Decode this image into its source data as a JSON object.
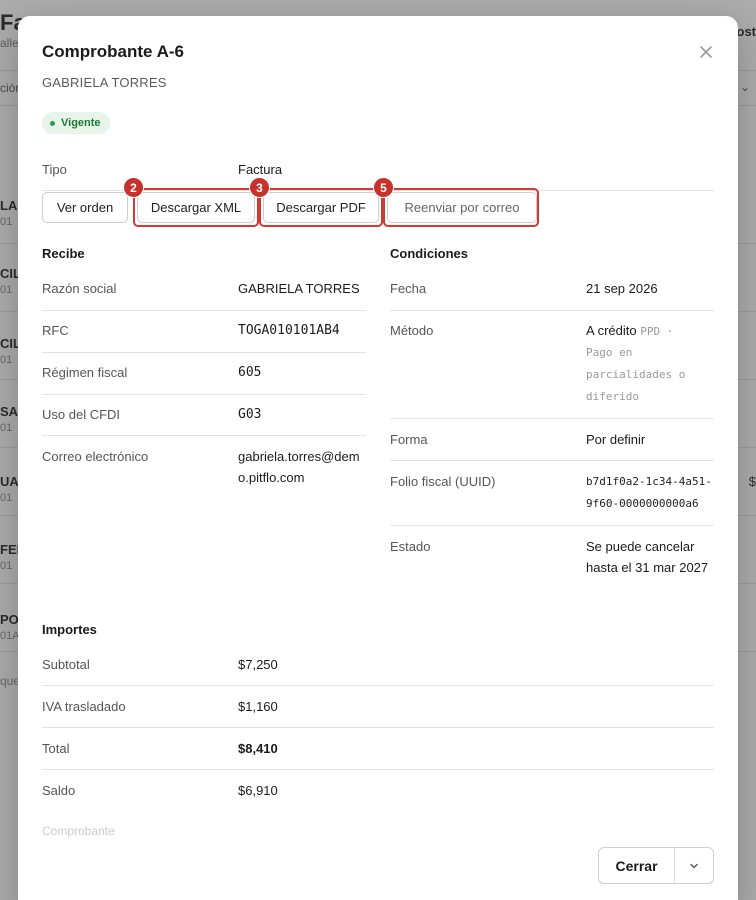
{
  "background": {
    "title": "Fac",
    "subtitle": "alle",
    "tab_text": "ción",
    "right_text": "ost",
    "rows": [
      {
        "name": "LA",
        "id": "01"
      },
      {
        "name": "CIL",
        "id": "01"
      },
      {
        "name": "CIL",
        "id": "01"
      },
      {
        "name": "SAN",
        "id": "01"
      },
      {
        "name": "UA",
        "id": "01",
        "amount": "$"
      },
      {
        "name": "FER",
        "id": "01"
      },
      {
        "name": "POR",
        "id": "01A"
      }
    ],
    "footer_text": "que"
  },
  "modal": {
    "title": "Comprobante A-6",
    "subtitle": "GABRIELA TORRES",
    "close_icon": "close-icon",
    "status": "Vigente",
    "status_color": "#1e7a34",
    "tipo": {
      "label": "Tipo",
      "value": "Factura"
    },
    "actions": [
      {
        "label": "Ver orden"
      },
      {
        "label": "Descargar XML",
        "badge": "2"
      },
      {
        "label": "Descargar PDF",
        "badge": "3"
      },
      {
        "label": "Reenviar por correo",
        "badge": "5"
      }
    ],
    "highlight_color": "#d13a32",
    "recibe": {
      "heading": "Recibe",
      "rows": [
        {
          "label": "Razón social",
          "value": "GABRIELA TORRES"
        },
        {
          "label": "RFC",
          "value": "TOGA010101AB4"
        },
        {
          "label": "Régimen fiscal",
          "value": "605"
        },
        {
          "label": "Uso del CFDI",
          "value": "G03"
        },
        {
          "label": "Correo electrónico",
          "value": "gabriela.torres@demo.pitflo.com"
        }
      ]
    },
    "condiciones": {
      "heading": "Condiciones",
      "fecha": {
        "label": "Fecha",
        "value": "21 sep 2026"
      },
      "metodo": {
        "label": "Método",
        "value": "A crédito",
        "code": "PPD ·",
        "description": "Pago en parcialidades o diferido"
      },
      "forma": {
        "label": "Forma",
        "value": "Por definir"
      },
      "folio": {
        "label": "Folio fiscal (UUID)",
        "value": "b7d1f0a2-1c34-4a51-9f60-0000000000a6"
      },
      "estado": {
        "label": "Estado",
        "value": "Se puede cancelar hasta el 31 mar 2027"
      }
    },
    "importes": {
      "heading": "Importes",
      "rows": [
        {
          "label": "Subtotal",
          "value": "$7,250"
        },
        {
          "label": "IVA trasladado",
          "value": "$1,160"
        },
        {
          "label": "Total",
          "value": "$8,410"
        },
        {
          "label": "Saldo",
          "value": "$6,910"
        }
      ]
    },
    "faded_text": "Comprobante",
    "footer": {
      "close_label": "Cerrar",
      "menu_icon": "chevron-down-icon"
    }
  }
}
